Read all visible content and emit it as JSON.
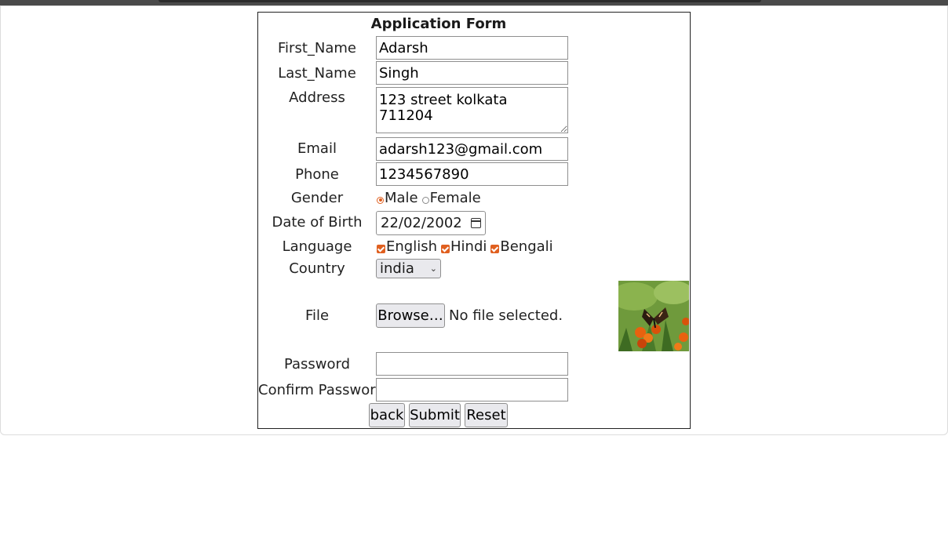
{
  "form": {
    "title": "Application Form",
    "first_name": {
      "label": "First_Name",
      "value": "Adarsh"
    },
    "last_name": {
      "label": "Last_Name",
      "value": "Singh"
    },
    "address": {
      "label": "Address",
      "value": "123 street kolkata 711204"
    },
    "email": {
      "label": "Email",
      "value": "adarsh123@gmail.com"
    },
    "phone": {
      "label": "Phone",
      "value": "1234567890"
    },
    "gender": {
      "label": "Gender",
      "options": [
        "Male",
        "Female"
      ],
      "selected": "Male"
    },
    "dob": {
      "label": "Date of Birth",
      "value": "22/02/2002"
    },
    "language": {
      "label": "Language",
      "options": [
        "English",
        "Hindi",
        "Bengali"
      ],
      "checked": [
        "English",
        "Hindi",
        "Bengali"
      ]
    },
    "country": {
      "label": "Country",
      "value": "india"
    },
    "file": {
      "label": "File",
      "button": "Browse…",
      "status": "No file selected."
    },
    "password": {
      "label": "Password",
      "value": ""
    },
    "confirm_password": {
      "label": "Confirm Password",
      "value": ""
    },
    "buttons": {
      "back": "back",
      "submit": "Submit",
      "reset": "Reset"
    }
  },
  "colors": {
    "accent": "#e06020",
    "border": "#222222"
  },
  "image": {
    "subject": "butterfly-on-marigold-flowers"
  }
}
